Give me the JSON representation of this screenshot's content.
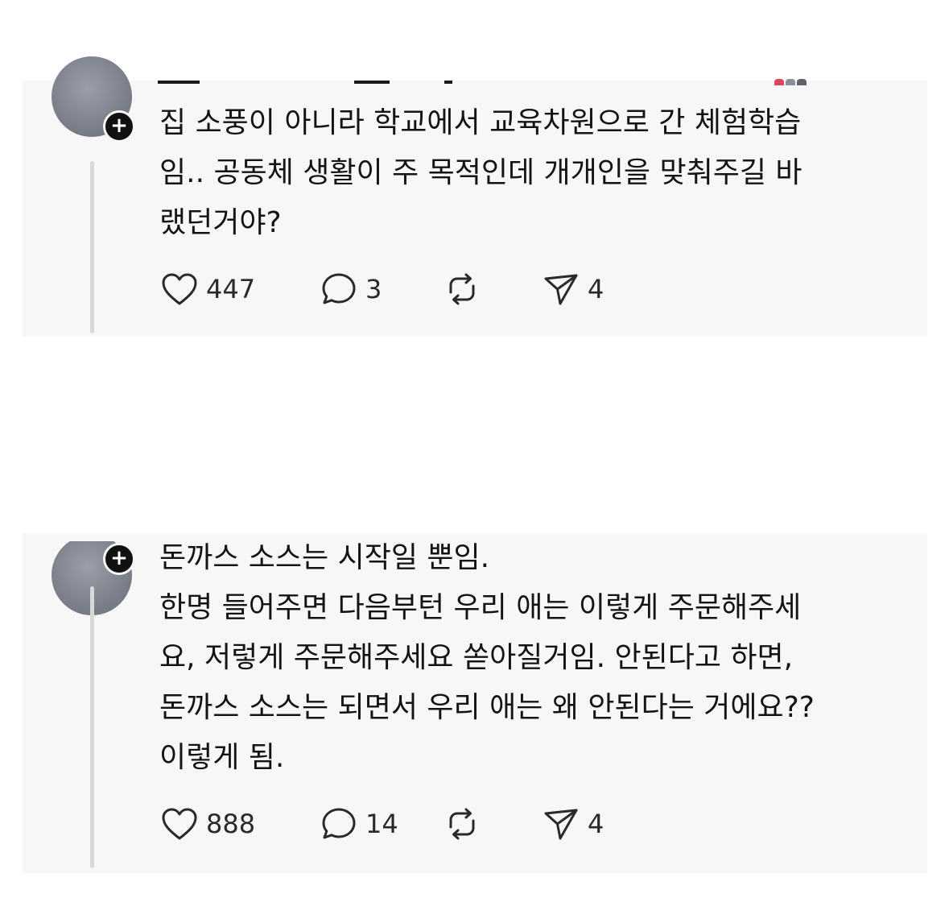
{
  "posts": [
    {
      "text_lines": [
        "집 소풍이 아니라 학교에서 교육차원으로 간 체험학습",
        "임.. 공동체 생활이 주 목적인데 개개인을 맞춰주길 바",
        "랬던거야?"
      ],
      "likes": "447",
      "replies": "3",
      "shares": "4"
    },
    {
      "text_lines": [
        "돈까스 소스는 시작일 뿐임.",
        "한명 들어주면 다음부턴 우리 애는 이렇게 주문해주세",
        "요, 저렇게 주문해주세요 쏟아질거임. 안된다고 하면,",
        "돈까스 소스는 되면서 우리 애는 왜 안된다는 거에요??",
        "이렇게 됨."
      ],
      "likes": "888",
      "replies": "14",
      "shares": "4"
    }
  ],
  "icons": {
    "like": "heart-icon",
    "reply": "speech-bubble-icon",
    "repost": "repost-icon",
    "share": "send-icon",
    "follow": "plus-icon"
  },
  "follow_symbol": "+",
  "colors": {
    "card_background": "#f7f7f7",
    "text": "#141414",
    "icon": "#2a2a2a",
    "thread_line": "#d8d8d8",
    "badge": "#111111"
  }
}
